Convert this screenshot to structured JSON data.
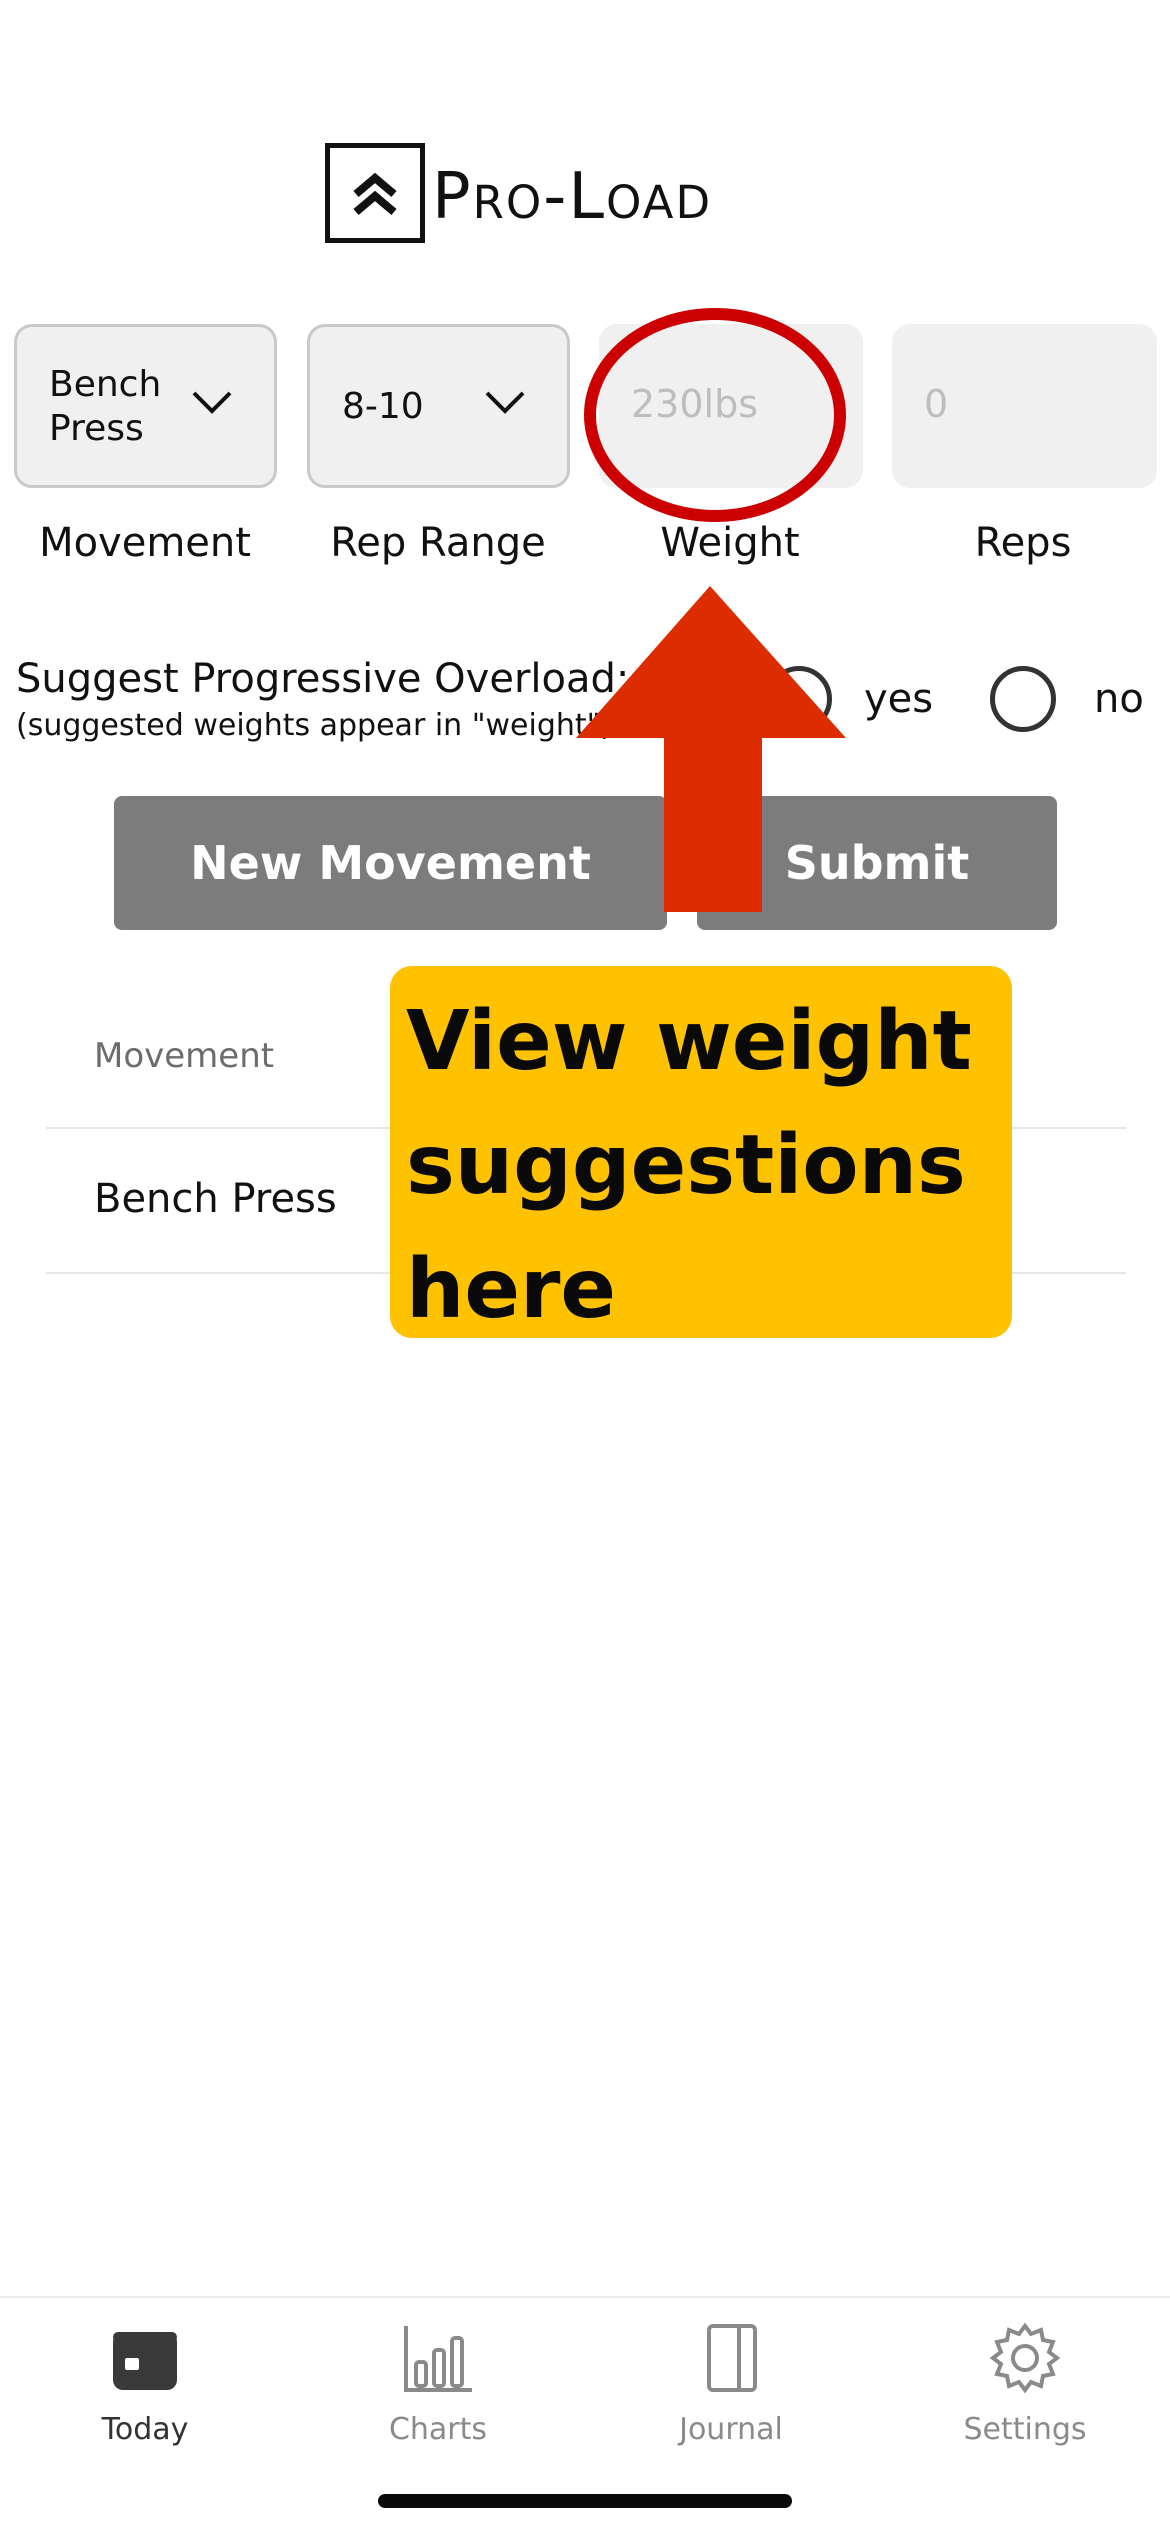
{
  "app": {
    "logo_text": "Pro-Load"
  },
  "form": {
    "movement": {
      "value": "Bench\nPress",
      "value_line1": "Bench",
      "value_line2": "Press",
      "label": "Movement"
    },
    "rep_range": {
      "value": "8-10",
      "label": "Rep Range"
    },
    "weight": {
      "placeholder": "230lbs",
      "label": "Weight"
    },
    "reps": {
      "placeholder": "0",
      "label": "Reps"
    }
  },
  "overload": {
    "title": "Suggest Progressive Overload:",
    "subtitle": "(suggested weights appear in \"weight\")",
    "options": [
      {
        "label": "yes",
        "selected": false
      },
      {
        "label": "no",
        "selected": false
      }
    ]
  },
  "buttons": {
    "new_movement": "New Movement",
    "submit": "Submit"
  },
  "table": {
    "headers": [
      "Movement"
    ],
    "rows": [
      [
        "Bench Press"
      ]
    ]
  },
  "annotation": {
    "callout_line1": "View weight",
    "callout_line2": "suggestions",
    "callout_line3": "here",
    "ellipse_color": "#cc0000",
    "arrow_color": "#dd2c00",
    "callout_color": "#fec200"
  },
  "tabbar": {
    "tabs": [
      {
        "label": "Today",
        "icon": "calendar-icon",
        "active": true
      },
      {
        "label": "Charts",
        "icon": "bar-chart-icon",
        "active": false
      },
      {
        "label": "Journal",
        "icon": "book-icon",
        "active": false
      },
      {
        "label": "Settings",
        "icon": "gear-icon",
        "active": false
      }
    ]
  }
}
